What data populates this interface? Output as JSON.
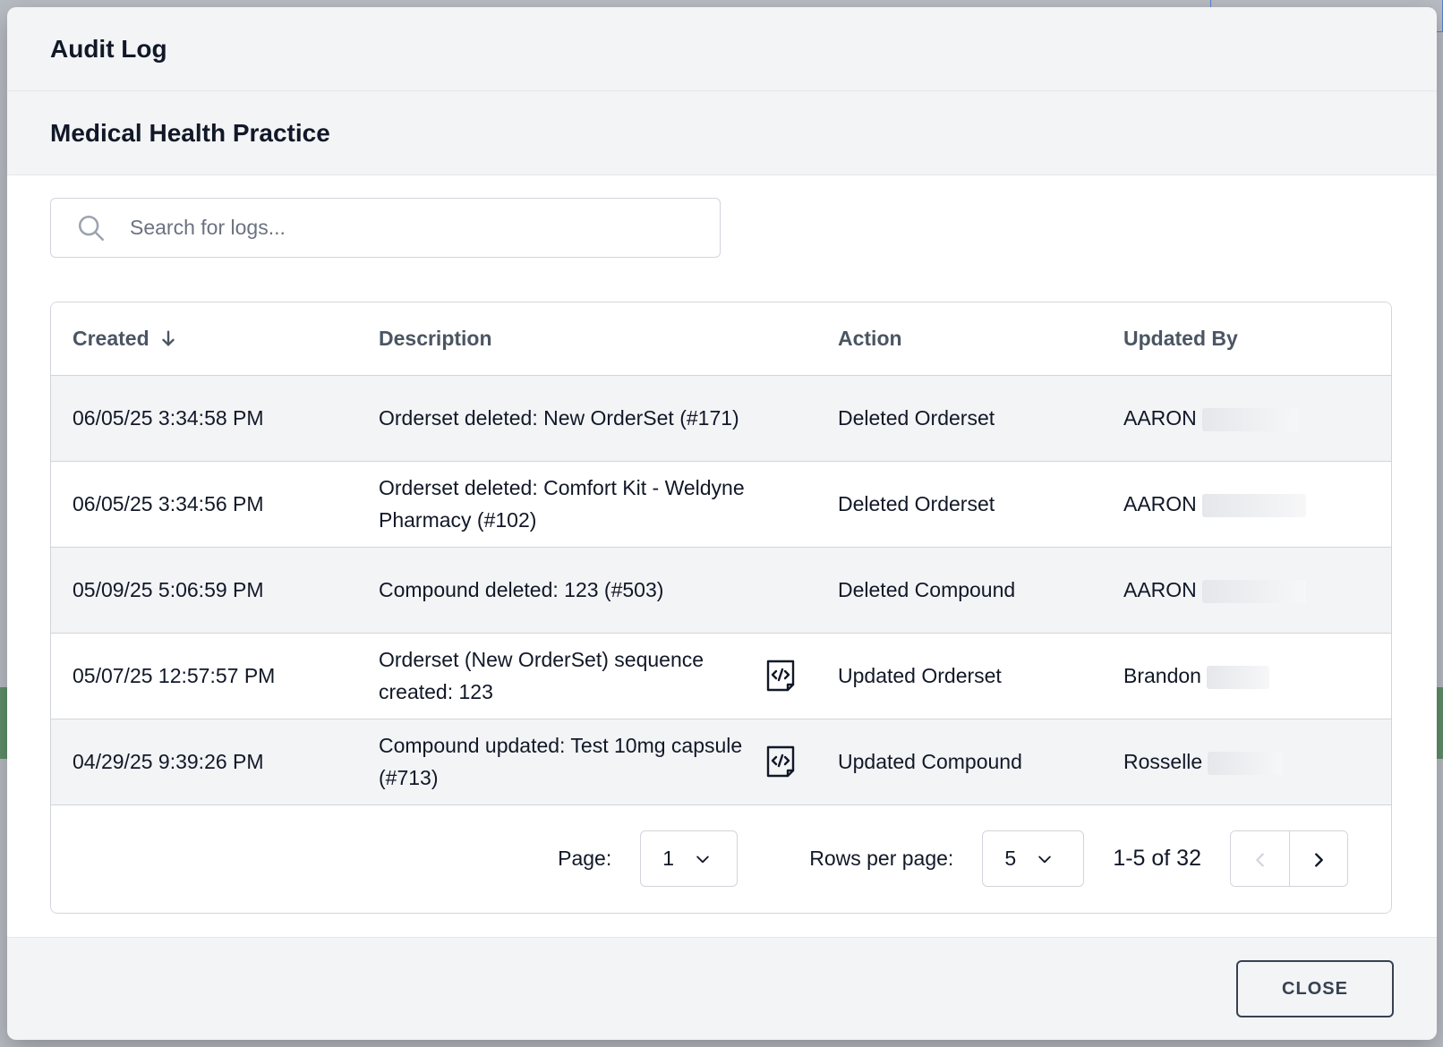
{
  "modal": {
    "title": "Audit Log",
    "subtitle": "Medical Health Practice",
    "close_label": "CLOSE"
  },
  "search": {
    "placeholder": "Search for logs...",
    "value": ""
  },
  "table": {
    "columns": {
      "created": "Created",
      "description": "Description",
      "action": "Action",
      "updated_by": "Updated By"
    },
    "sort": {
      "column": "created",
      "direction": "descending"
    },
    "rows": [
      {
        "created": "06/05/25 3:34:58 PM",
        "description": "Orderset deleted: New OrderSet (#171)",
        "has_code": false,
        "action": "Deleted Orderset",
        "updated_by": "AARON"
      },
      {
        "created": "06/05/25 3:34:56 PM",
        "description": "Orderset deleted: Comfort Kit - Weldyne Pharmacy (#102)",
        "has_code": false,
        "action": "Deleted Orderset",
        "updated_by": "AARON"
      },
      {
        "created": "05/09/25 5:06:59 PM",
        "description": "Compound deleted: 123 (#503)",
        "has_code": false,
        "action": "Deleted Compound",
        "updated_by": "AARON"
      },
      {
        "created": "05/07/25 12:57:57 PM",
        "description": "Orderset (New OrderSet) sequence created: 123",
        "has_code": true,
        "action": "Updated Orderset",
        "updated_by": "Brandon"
      },
      {
        "created": "04/29/25 9:39:26 PM",
        "description": "Compound updated: Test 10mg capsule (#713)",
        "has_code": true,
        "action": "Updated Compound",
        "updated_by": "Rosselle"
      }
    ]
  },
  "pagination": {
    "page_label": "Page:",
    "page_value": "1",
    "rows_label": "Rows per page:",
    "rows_value": "5",
    "range": "1-5 of 32"
  },
  "icons": {
    "search": "search-icon",
    "sort": "arrow-down-icon",
    "code": "code-document-icon",
    "chevron": "chevron-down-icon",
    "prev": "chevron-left-icon",
    "next": "chevron-right-icon"
  }
}
